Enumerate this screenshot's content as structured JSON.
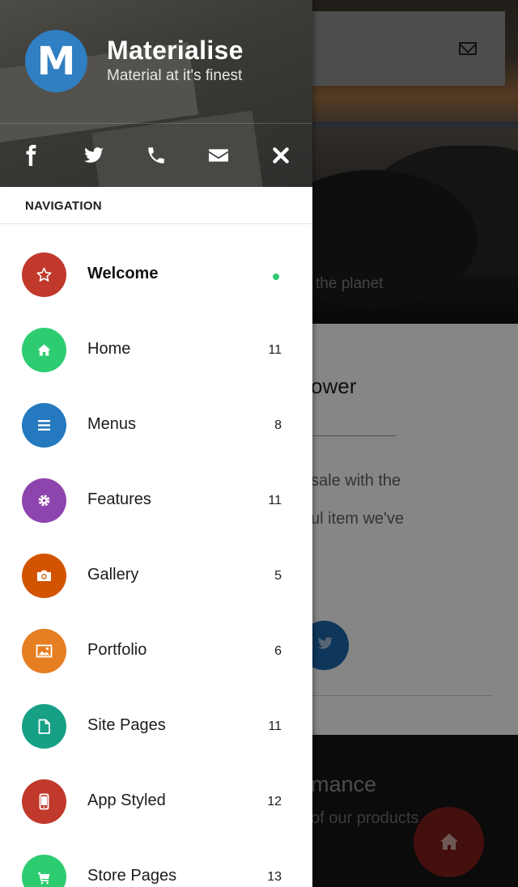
{
  "colors": {
    "avatar": "#2f7fc2",
    "active_dot": "#2ecc71",
    "drawer_bg": "#ffffff",
    "header_bg": "#3c3a36",
    "scrim": "rgba(0,0,0,0.45)"
  },
  "brand": {
    "letter": "M",
    "title": "Materialise",
    "subtitle": "Material at it's finest"
  },
  "social_icons": [
    "facebook-icon",
    "twitter-icon",
    "phone-icon",
    "envelope-icon",
    "close-icon"
  ],
  "navigation": {
    "heading": "NAVIGATION",
    "items": [
      {
        "label": "Welcome",
        "icon": "star-icon",
        "color": "#c0392b",
        "count": "",
        "active": true
      },
      {
        "label": "Home",
        "icon": "home-icon",
        "color": "#2ecc71",
        "count": "11"
      },
      {
        "label": "Menus",
        "icon": "bars-icon",
        "color": "#2479bf",
        "count": "8"
      },
      {
        "label": "Features",
        "icon": "gear-icon",
        "color": "#8e44ad",
        "count": "11"
      },
      {
        "label": "Gallery",
        "icon": "camera-icon",
        "color": "#d35400",
        "count": "5"
      },
      {
        "label": "Portfolio",
        "icon": "image-icon",
        "color": "#e67e22",
        "count": "6"
      },
      {
        "label": "Site Pages",
        "icon": "file-icon",
        "color": "#16a085",
        "count": "11"
      },
      {
        "label": "App Styled",
        "icon": "mobile-icon",
        "color": "#c0392b",
        "count": "12"
      },
      {
        "label": "Store Pages",
        "icon": "cart-icon",
        "color": "#2ecc71",
        "count": "13"
      }
    ]
  },
  "background": {
    "hero_text": "the planet",
    "section_title": "ower",
    "body_lines": [
      "sale with the",
      "ul item we've"
    ],
    "footer_title": "mance",
    "footer_text": "of our products"
  }
}
